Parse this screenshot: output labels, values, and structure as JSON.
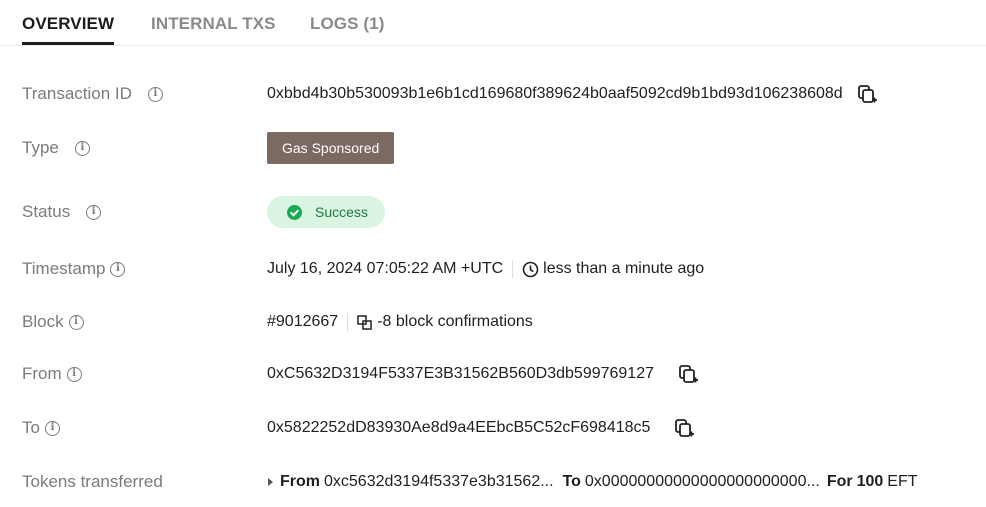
{
  "tabs": [
    {
      "label": "OVERVIEW"
    },
    {
      "label": "INTERNAL TXS"
    },
    {
      "label": "LOGS (1)"
    }
  ],
  "fields": {
    "transaction_id": {
      "label": "Transaction ID",
      "value": "0xbbd4b30b530093b1e6b1cd169680f389624b0aaf5092cd9b1bd93d106238608d"
    },
    "type": {
      "label": "Type",
      "value": "Gas Sponsored"
    },
    "status": {
      "label": "Status",
      "value": "Success"
    },
    "timestamp": {
      "label": "Timestamp",
      "value": "July 16, 2024 07:05:22 AM +UTC",
      "relative": "less than a minute ago"
    },
    "block": {
      "label": "Block",
      "value": "#9012667",
      "confirmations": "-8 block confirmations"
    },
    "from": {
      "label": "From",
      "value": "0xC5632D3194F5337E3B31562B560D3db599769127"
    },
    "to": {
      "label": "To",
      "value": "0x5822252dD83930Ae8d9a4EEbcB5C52cF698418c5"
    },
    "tokens_transferred": {
      "label": "Tokens transferred",
      "from_label": "From",
      "from_value": "0xc5632d3194f5337e3b31562...",
      "to_label": "To",
      "to_value": "0x00000000000000000000000...",
      "for_label": "For",
      "amount": "100",
      "token": "EFT"
    }
  },
  "info_glyph": "i",
  "colors": {
    "type_badge": "#7b6a62",
    "status_bg": "#d9f5e2",
    "status_text": "#1f7a3f",
    "status_check": "#18a957"
  }
}
